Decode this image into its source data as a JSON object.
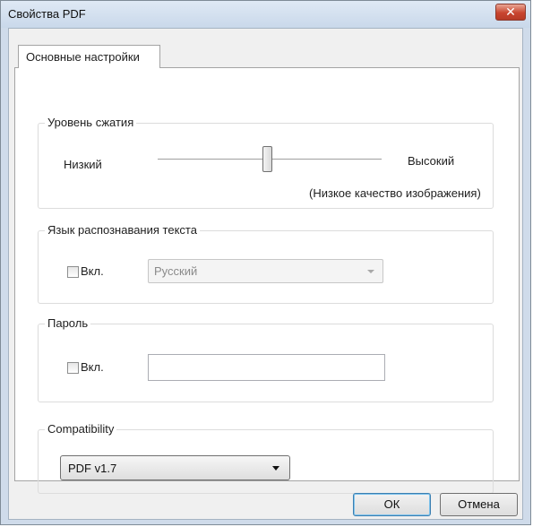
{
  "window": {
    "title": "Свойства PDF",
    "close_glyph": "✕"
  },
  "tabs": [
    {
      "label": "Основные настройки",
      "selected": true
    }
  ],
  "compression": {
    "group_label": "Уровень сжатия",
    "low_label": "Низкий",
    "high_label": "Высокий",
    "quality_note": "(Низкое качество изображения)",
    "level_fraction": 0.49
  },
  "ocr_language": {
    "group_label": "Язык распознавания текста",
    "enable_label": "Вкл.",
    "enabled": false,
    "language_value": "Русский"
  },
  "password": {
    "group_label": "Пароль",
    "enable_label": "Вкл.",
    "enabled": false,
    "value": ""
  },
  "compatibility": {
    "group_label": "Compatibility",
    "selected": "PDF v1.7"
  },
  "buttons": {
    "ok": "ОК",
    "cancel": "Отмена"
  },
  "colors": {
    "close_button": "#c8452f",
    "default_button_border": "#3c7fb1",
    "window_frame": "#cfdbea"
  }
}
